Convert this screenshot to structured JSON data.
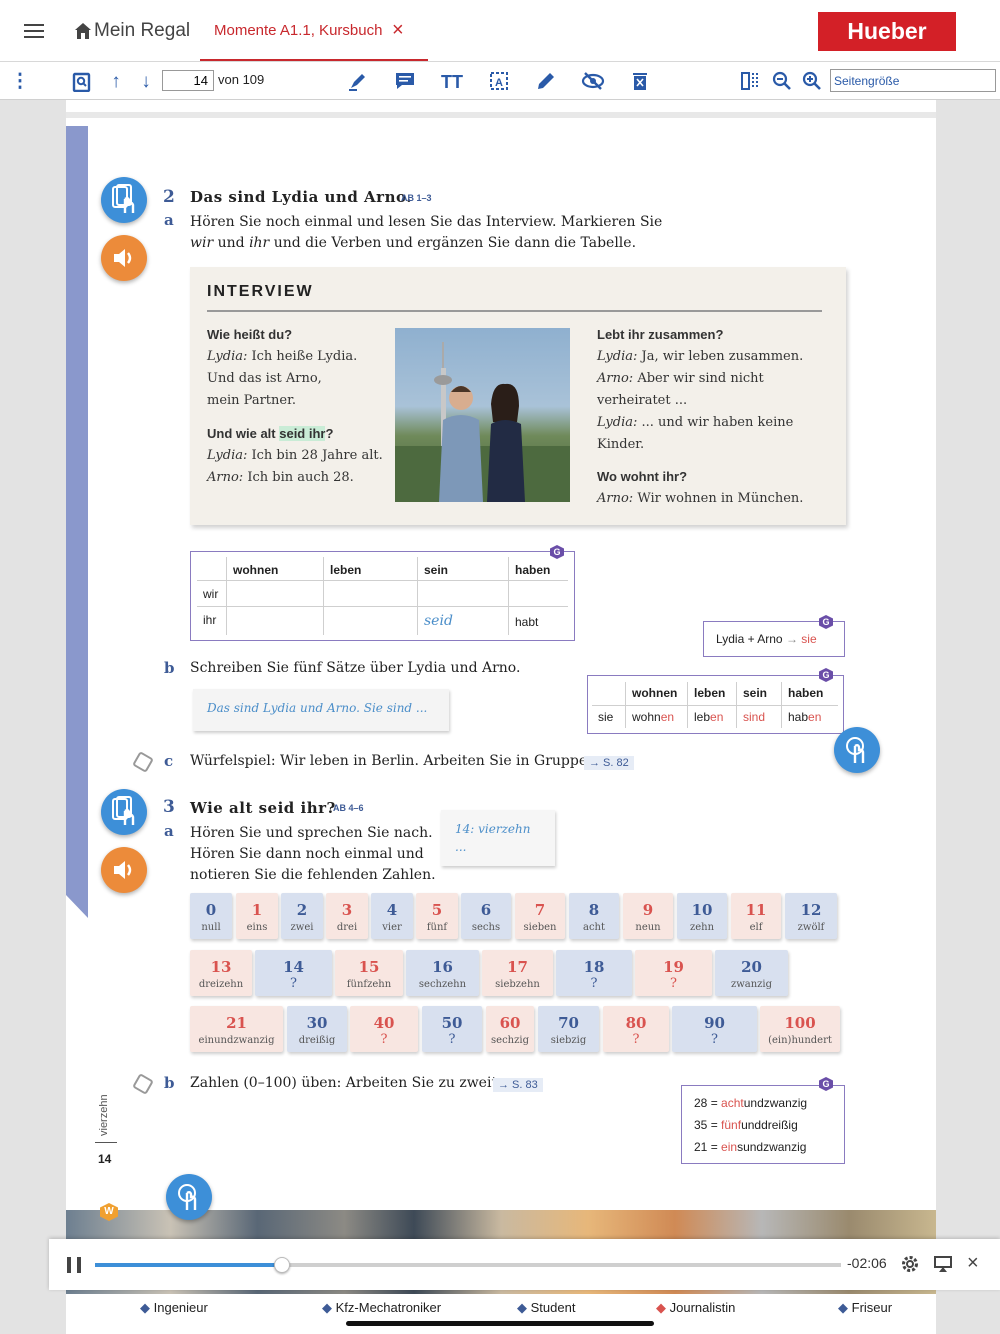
{
  "topbar": {
    "shelf": "Mein Regal",
    "tab": "Momente A1.1, Kursbuch",
    "close": "×",
    "brand": "Hueber"
  },
  "toolbar": {
    "page_value": "14",
    "page_total": "von 109",
    "zoom_value": "Seitengröße"
  },
  "ex2": {
    "num": "2",
    "title": "Das sind Lydia und Arno.",
    "ab": "AB 1–3",
    "a_letter": "a",
    "a_line1": "Hören Sie noch einmal und lesen Sie das Interview. Markieren Sie",
    "a_line2_1": "wir",
    "a_line2_2": " und ",
    "a_line2_3": "ihr",
    "a_line2_4": " und die Verben und ergänzen Sie dann die Tabelle."
  },
  "interview": {
    "title": "INTERVIEW",
    "q1": "Wie heißt du?",
    "l1_who": "Lydia:",
    "l1": " Ich heiße Lydia.",
    "l2": "Und das ist Arno,",
    "l3": "mein Partner.",
    "q2_pre": "Und wie alt ",
    "q2_hl": "seid ihr",
    "q2_post": "?",
    "l4_who": "Lydia:",
    "l4": " Ich bin 28 Jahre alt.",
    "l5_who": "Arno:",
    "l5": " Ich bin auch 28.",
    "q3": "Lebt ihr zusammen?",
    "r1_who": "Lydia:",
    "r1": " Ja, wir leben zusammen.",
    "r2_who": "Arno:",
    "r2": " Aber wir sind nicht",
    "r3": "verheiratet ...",
    "r4_who": "Lydia:",
    "r4": " ... und wir haben keine",
    "r5": "Kinder.",
    "q4": "Wo wohnt ihr?",
    "r6_who": "Arno:",
    "r6": " Wir wohnen in München."
  },
  "table1": {
    "g": "G",
    "headers": [
      "wohnen",
      "leben",
      "sein",
      "haben"
    ],
    "rows": [
      {
        "p": "wir",
        "v": [
          "",
          "",
          "",
          ""
        ]
      },
      {
        "p": "ihr",
        "v": [
          "",
          "",
          "seid",
          "habt"
        ]
      }
    ]
  },
  "note_lydia": {
    "g": "G",
    "pre": "Lydia + Arno",
    "arrow": "→",
    "post": "sie"
  },
  "table2": {
    "g": "G",
    "headers": [
      "wohnen",
      "leben",
      "sein",
      "haben"
    ],
    "p": "sie",
    "stems": [
      "wohn",
      "leb",
      "",
      "hab"
    ],
    "ends": [
      "en",
      "en",
      "sind",
      "en"
    ]
  },
  "ex2b": {
    "letter": "b",
    "text": "Schreiben Sie fünf Sätze über Lydia und Arno.",
    "hint": "Das sind Lydia und Arno. Sie sind ..."
  },
  "ex2c": {
    "letter": "c",
    "text": "Würfelspiel: Wir leben in Berlin. Arbeiten Sie in Gruppen.",
    "ref": "→ S. 82"
  },
  "ex3": {
    "num": "3",
    "title": "Wie alt seid ihr?",
    "ab": "AB 4–6",
    "a_letter": "a",
    "l1": "Hören Sie und sprechen Sie nach.",
    "l2": "Hören Sie dann noch einmal und",
    "l3": "notieren Sie die fehlenden Zahlen.",
    "note1": "14: vierzehn",
    "note2": "..."
  },
  "numbers": [
    {
      "n": "0",
      "w": "null",
      "c": "b"
    },
    {
      "n": "1",
      "w": "eins",
      "c": "r"
    },
    {
      "n": "2",
      "w": "zwei",
      "c": "b"
    },
    {
      "n": "3",
      "w": "drei",
      "c": "r"
    },
    {
      "n": "4",
      "w": "vier",
      "c": "b"
    },
    {
      "n": "5",
      "w": "fünf",
      "c": "r"
    },
    {
      "n": "6",
      "w": "sechs",
      "c": "b"
    },
    {
      "n": "7",
      "w": "sieben",
      "c": "r"
    },
    {
      "n": "8",
      "w": "acht",
      "c": "b"
    },
    {
      "n": "9",
      "w": "neun",
      "c": "r"
    },
    {
      "n": "10",
      "w": "zehn",
      "c": "b"
    },
    {
      "n": "11",
      "w": "elf",
      "c": "r"
    },
    {
      "n": "12",
      "w": "zwölf",
      "c": "b"
    },
    {
      "n": "13",
      "w": "dreizehn",
      "c": "r"
    },
    {
      "n": "14",
      "w": "?",
      "c": "b"
    },
    {
      "n": "15",
      "w": "fünfzehn",
      "c": "r"
    },
    {
      "n": "16",
      "w": "sechzehn",
      "c": "b"
    },
    {
      "n": "17",
      "w": "siebzehn",
      "c": "r"
    },
    {
      "n": "18",
      "w": "?",
      "c": "b"
    },
    {
      "n": "19",
      "w": "?",
      "c": "r"
    },
    {
      "n": "20",
      "w": "zwanzig",
      "c": "b"
    },
    {
      "n": "21",
      "w": "einundzwanzig",
      "c": "r"
    },
    {
      "n": "30",
      "w": "dreißig",
      "c": "b"
    },
    {
      "n": "40",
      "w": "?",
      "c": "r"
    },
    {
      "n": "50",
      "w": "?",
      "c": "b"
    },
    {
      "n": "60",
      "w": "sechzig",
      "c": "r"
    },
    {
      "n": "70",
      "w": "siebzig",
      "c": "b"
    },
    {
      "n": "80",
      "w": "?",
      "c": "r"
    },
    {
      "n": "90",
      "w": "?",
      "c": "b"
    },
    {
      "n": "100",
      "w": "(ein)hundert",
      "c": "r"
    }
  ],
  "ex3b": {
    "letter": "b",
    "text": "Zahlen (0–100) üben: Arbeiten Sie zu zweit.",
    "ref": "→ S. 83"
  },
  "numbox": {
    "g": "G",
    "l1_n": "28",
    "l1_eq": " = ",
    "l1_a": "acht",
    "l1_b": "undzwanzig",
    "l2_n": "35",
    "l2_eq": " = ",
    "l2_a": "fünf",
    "l2_b": "unddreißig",
    "l3_n": "21",
    "l3_eq": " = ",
    "l3_a": "ein",
    "l3_b": "sundzwanzig"
  },
  "pagefoot": {
    "word": "vierzehn",
    "num": "14"
  },
  "audio": {
    "time": "-02:06",
    "progress": 0.25
  },
  "jobs": [
    "Ingenieur",
    "Kfz-Mechatroniker",
    "Student",
    "Journalistin",
    "Friseur"
  ],
  "badge_w": "W"
}
